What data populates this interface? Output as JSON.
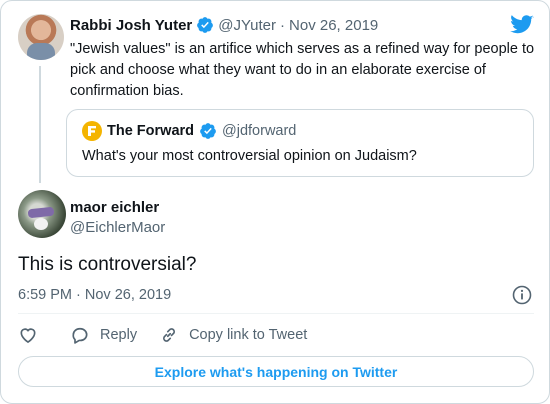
{
  "parent_tweet": {
    "author_name": "Rabbi Josh Yuter",
    "handle": "@JYuter",
    "separator": "·",
    "date": "Nov 26, 2019",
    "text": "\"Jewish values\" is an artifice which serves as a refined way for people to pick and choose what they want to do in an elaborate exercise of confirmation bias."
  },
  "quoted_tweet": {
    "author_name": "The Forward",
    "handle": "@jdforward",
    "text": "What's your most controversial opinion on Judaism?"
  },
  "reply_tweet": {
    "author_name": "maor eichler",
    "handle": "@EichlerMaor",
    "text": "This is controversial?",
    "timestamp": "6:59 PM · Nov 26, 2019"
  },
  "actions": {
    "like_label": "",
    "reply_label": "Reply",
    "copy_link_label": "Copy link to Tweet"
  },
  "footer": {
    "explore_label": "Explore what's happening on Twitter"
  },
  "colors": {
    "accent": "#1d9bf0",
    "muted_text": "#536471",
    "border": "#cfd9de",
    "forward_logo": "#f4b400"
  },
  "icons": [
    "twitter-bird-icon",
    "verified-badge-icon",
    "info-icon",
    "heart-icon",
    "reply-bubble-icon",
    "link-icon"
  ]
}
